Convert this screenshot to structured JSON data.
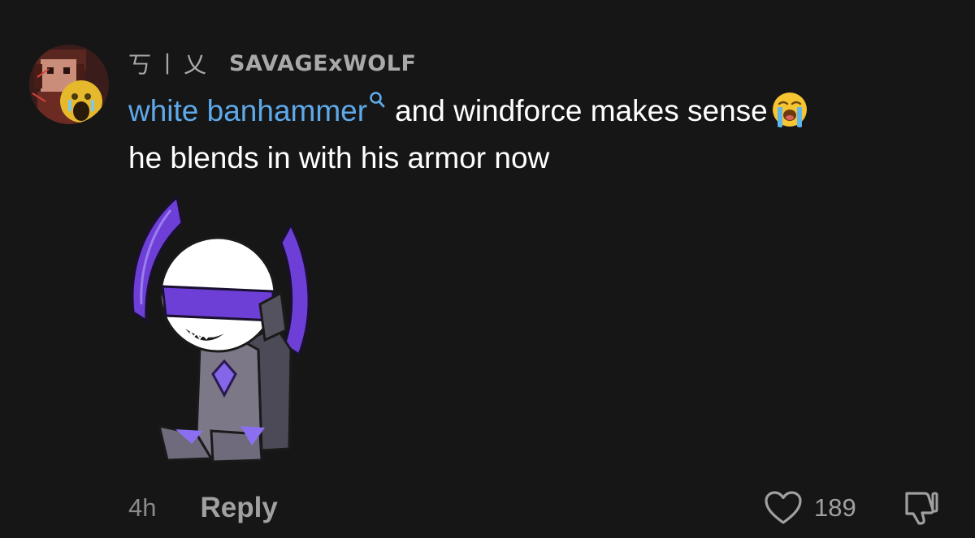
{
  "comment": {
    "username_prefix": "丂丨乂",
    "username": "SAVAGExWOLF",
    "text": {
      "mention": "white banhammer",
      "body": "and windforce makes sense",
      "second_line": "he blends in with his armor now"
    },
    "time": "4h",
    "reply_label": "Reply",
    "like_count": "189"
  },
  "colors": {
    "background": "#161616",
    "mention": "#5ea9ea",
    "secondary_text": "#a0a0a0",
    "armor_purple": "#6d3fd6"
  },
  "icons": {
    "mention_search": "search-icon",
    "emoji": "loudly-crying-face-icon",
    "like": "heart-outline-icon",
    "dislike": "thumbs-down-icon"
  }
}
